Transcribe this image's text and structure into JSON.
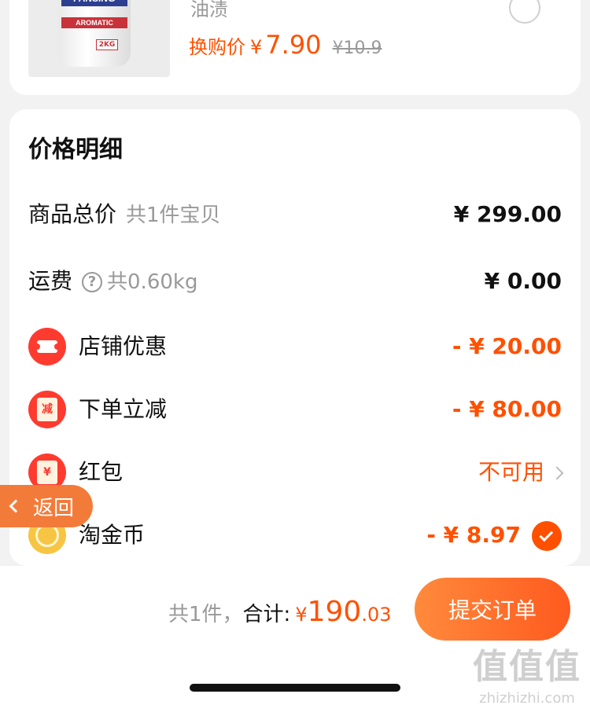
{
  "product": {
    "brand_text": "FANSING",
    "band_text": "AROMATIC",
    "weight_tag": "2KG",
    "description": "油渍",
    "swap_label": "换购价",
    "currency": "¥",
    "swap_price": "7.90",
    "original_price": "¥10.9"
  },
  "price_detail": {
    "title": "价格明细",
    "goods_total": {
      "label": "商品总价",
      "sub": "共1件宝贝",
      "value": "¥ 299.00"
    },
    "shipping": {
      "label": "运费",
      "help_glyph": "?",
      "sub": "共0.60kg",
      "value": "¥ 0.00"
    },
    "store_discount": {
      "label": "店铺优惠",
      "value": "- ¥ 20.00",
      "icon": "ticket-icon"
    },
    "order_discount": {
      "label": "下单立减",
      "icon_text": "减",
      "value": "- ¥ 80.00",
      "icon": "discount-envelope-icon"
    },
    "red_packet": {
      "label": "红包",
      "icon_text": "¥",
      "value": "不可用",
      "icon": "red-packet-icon"
    },
    "coins": {
      "label": "淘金币",
      "value": "- ¥ 8.97",
      "icon": "gold-coin-icon"
    }
  },
  "back_button": {
    "label": "返回"
  },
  "footer": {
    "count": "共1件，",
    "total_label": "合计:",
    "currency": "¥",
    "total_int": "190",
    "total_dec": ".03",
    "submit_label": "提交订单"
  },
  "watermark": {
    "logo": "值值值",
    "url": "zhizhizhi.com"
  },
  "colors": {
    "accent": "#ff5000",
    "badge_red": "#ff3b30",
    "coin_gold": "#f7c544"
  }
}
